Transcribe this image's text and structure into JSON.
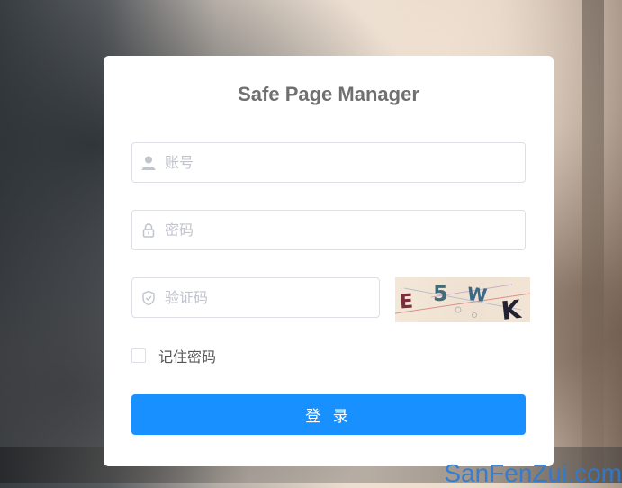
{
  "app": {
    "title": "Safe Page Manager"
  },
  "form": {
    "account_placeholder": "账号",
    "account_value": "",
    "password_placeholder": "密码",
    "password_value": "",
    "captcha_placeholder": "验证码",
    "captcha_value": "",
    "captcha_image_text": "E5WK",
    "remember_label": "记住密码",
    "remember_checked": false,
    "login_label": "登 录"
  },
  "icons": {
    "account": "user-icon",
    "password": "lock-icon",
    "captcha": "shield-icon"
  },
  "colors": {
    "primary": "#1890ff",
    "border": "#dcdfe6",
    "placeholder": "#c0c4cc"
  },
  "watermark": "SanFenZui.com"
}
